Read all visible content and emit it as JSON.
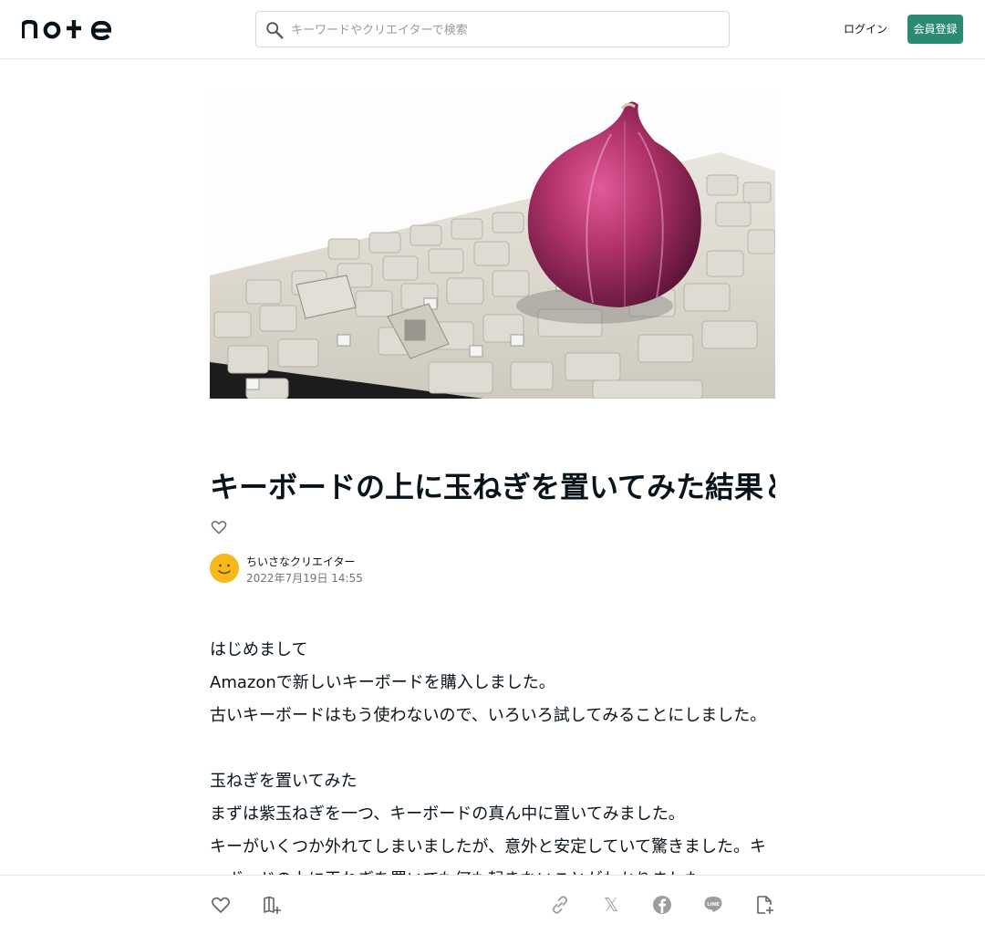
{
  "header": {
    "logo_text": "note",
    "search_placeholder": "キーワードやクリエイターで検索",
    "login_label": "ログイン",
    "signup_label": "会員登録"
  },
  "hero": {
    "alt": "紫玉ねぎとキーボード"
  },
  "article": {
    "title": "キーボードの上に玉ねぎを置いてみた結果と考察について",
    "author": "ちいさなクリエイター",
    "date": "2022年7月19日 14:55",
    "paragraphs": [
      "はじめまして",
      "Amazonで新しいキーボードを購入しました。",
      "古いキーボードはもう使わないので、いろいろ試してみることにしました。",
      "",
      "玉ねぎを置いてみた",
      "まずは紫玉ねぎを一つ、キーボードの真ん中に置いてみました。",
      "キーがいくつか外れてしまいましたが、意外と安定していて驚きました。キーボードの上に玉ねぎを置いても何も起きないことがわかりました。"
    ]
  },
  "icons": {
    "search": "search-icon",
    "heart": "heart-icon",
    "magazine": "magazine-add-icon",
    "link": "link-icon",
    "x": "x-logo-icon",
    "facebook": "facebook-icon",
    "line": "line-icon",
    "note_add": "note-add-icon"
  },
  "bottom_bar": {
    "x_glyph": "𝕏"
  },
  "colors": {
    "accent": "#2a8a74",
    "text": "#08131a",
    "muted": "#6f7476",
    "icon": "#9a9ea1",
    "onion": "#b2336b"
  }
}
